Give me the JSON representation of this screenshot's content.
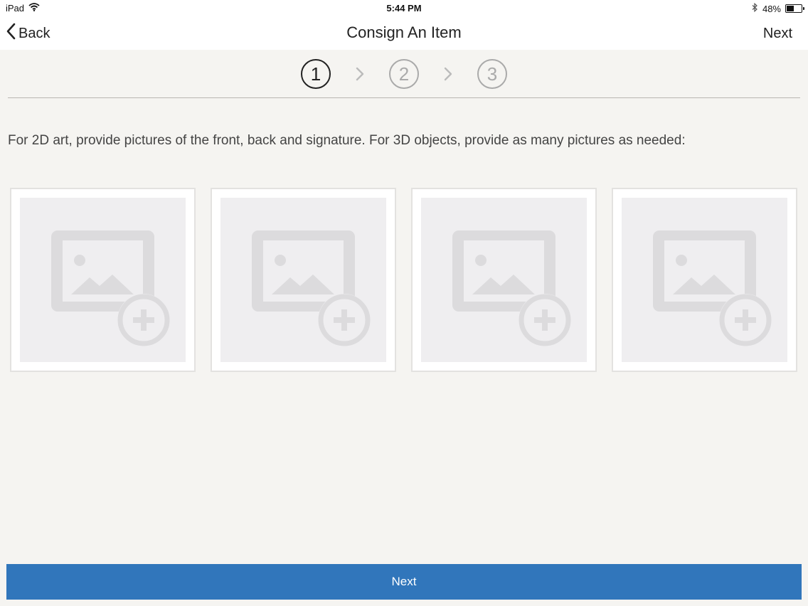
{
  "status_bar": {
    "device": "iPad",
    "time": "5:44 PM",
    "battery": "48%",
    "battery_level": 0.48,
    "icons": [
      "wifi-icon",
      "bluetooth-icon",
      "battery-icon"
    ]
  },
  "nav": {
    "back_label": "Back",
    "title": "Consign An Item",
    "next_label": "Next"
  },
  "steps": [
    {
      "label": "1",
      "active": true
    },
    {
      "label": "2",
      "active": false
    },
    {
      "label": "3",
      "active": false
    }
  ],
  "instructions": "For 2D art, provide pictures of the front, back and signature.  For 3D objects, provide as many pictures as needed:",
  "photo_slots": [
    {
      "icon": "add-photo-icon"
    },
    {
      "icon": "add-photo-icon"
    },
    {
      "icon": "add-photo-icon"
    },
    {
      "icon": "add-photo-icon"
    }
  ],
  "bottom_button": {
    "label": "Next",
    "color": "#3176bb"
  }
}
